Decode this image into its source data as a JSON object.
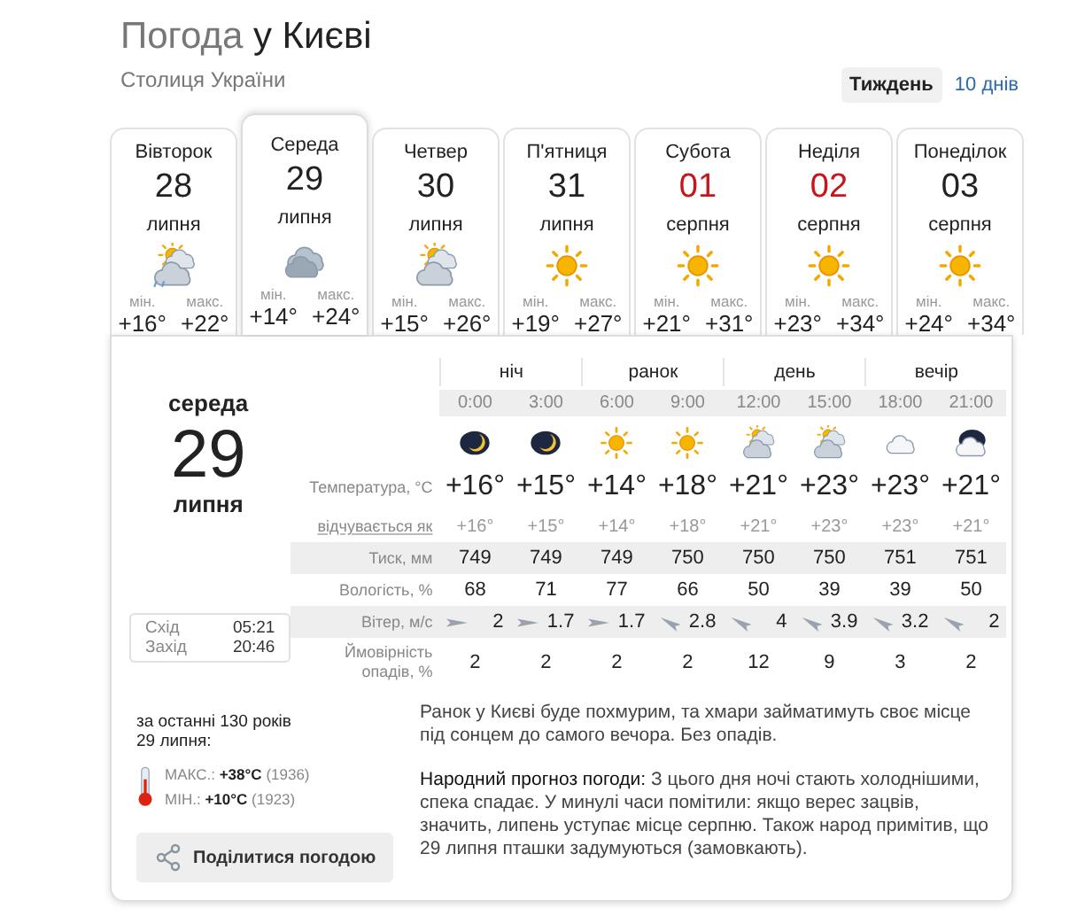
{
  "header": {
    "title_prefix": "Погода",
    "title_place": "у Києві",
    "subtitle": "Столиця України",
    "range_tabs": [
      {
        "label": "Тиждень",
        "selected": true
      },
      {
        "label": "10 днів",
        "selected": false
      }
    ]
  },
  "days": [
    {
      "weekday": "Вівторок",
      "date": "28",
      "month": "липня",
      "kind": "partly-rain",
      "min_label": "мін.",
      "max_label": "макс.",
      "min": "+16°",
      "max": "+22°",
      "selected": false,
      "weekend": false
    },
    {
      "weekday": "Середа",
      "date": "29",
      "month": "липня",
      "kind": "cloud",
      "min_label": "мін.",
      "max_label": "макс.",
      "min": "+14°",
      "max": "+24°",
      "selected": true,
      "weekend": false
    },
    {
      "weekday": "Четвер",
      "date": "30",
      "month": "липня",
      "kind": "partly",
      "min_label": "мін.",
      "max_label": "макс.",
      "min": "+15°",
      "max": "+26°",
      "selected": false,
      "weekend": false
    },
    {
      "weekday": "П'ятниця",
      "date": "31",
      "month": "липня",
      "kind": "sun",
      "min_label": "мін.",
      "max_label": "макс.",
      "min": "+19°",
      "max": "+27°",
      "selected": false,
      "weekend": false
    },
    {
      "weekday": "Субота",
      "date": "01",
      "month": "серпня",
      "kind": "sun",
      "min_label": "мін.",
      "max_label": "макс.",
      "min": "+21°",
      "max": "+31°",
      "selected": false,
      "weekend": true
    },
    {
      "weekday": "Неділя",
      "date": "02",
      "month": "серпня",
      "kind": "sun",
      "min_label": "мін.",
      "max_label": "макс.",
      "min": "+23°",
      "max": "+34°",
      "selected": false,
      "weekend": true
    },
    {
      "weekday": "Понеділок",
      "date": "03",
      "month": "серпня",
      "kind": "sun",
      "min_label": "мін.",
      "max_label": "макс.",
      "min": "+24°",
      "max": "+34°",
      "selected": false,
      "weekend": false
    }
  ],
  "detail": {
    "weekday": "середа",
    "date": "29",
    "month": "липня",
    "sun": {
      "rise_label": "Схід",
      "rise": "05:21",
      "set_label": "Захід",
      "set": "20:46"
    },
    "history": {
      "intro": "за останні 130 років\n29 липня:",
      "max_label": "МАКС.:",
      "max": "+38°C",
      "max_year": "(1936)",
      "min_label": "МІН.:",
      "min": "+10°C",
      "min_year": "(1923)"
    },
    "share_button": "Поділитися погодою",
    "periods": [
      "ніч",
      "ранок",
      "день",
      "вечір"
    ],
    "row_labels": {
      "temperature": "Температура, °C",
      "feels": "відчувається як",
      "pressure": "Тиск, мм",
      "humidity": "Вологість, %",
      "wind": "Вітер, м/с",
      "precip": "Ймовірність опадів, %"
    },
    "hours": [
      {
        "time": "0:00",
        "kind": "moon",
        "temp": "+16°",
        "feels": "+16°",
        "pressure": "749",
        "humidity": "68",
        "wind": {
          "speed": "2",
          "kind": "east"
        },
        "precip": "2"
      },
      {
        "time": "3:00",
        "kind": "moon",
        "temp": "+15°",
        "feels": "+15°",
        "pressure": "749",
        "humidity": "71",
        "wind": {
          "speed": "1.7",
          "kind": "east"
        },
        "precip": "2"
      },
      {
        "time": "6:00",
        "kind": "sun",
        "temp": "+14°",
        "feels": "+14°",
        "pressure": "749",
        "humidity": "77",
        "wind": {
          "speed": "1.7",
          "kind": "east"
        },
        "precip": "2"
      },
      {
        "time": "9:00",
        "kind": "sun",
        "temp": "+18°",
        "feels": "+18°",
        "pressure": "750",
        "humidity": "66",
        "wind": {
          "speed": "2.8",
          "kind": "southeast"
        },
        "precip": "2"
      },
      {
        "time": "12:00",
        "kind": "partly",
        "temp": "+21°",
        "feels": "+21°",
        "pressure": "750",
        "humidity": "50",
        "wind": {
          "speed": "4",
          "kind": "southeast"
        },
        "precip": "12"
      },
      {
        "time": "15:00",
        "kind": "partly",
        "temp": "+23°",
        "feels": "+23°",
        "pressure": "750",
        "humidity": "39",
        "wind": {
          "speed": "3.9",
          "kind": "southeast"
        },
        "precip": "9"
      },
      {
        "time": "18:00",
        "kind": "cloud-light",
        "temp": "+23°",
        "feels": "+23°",
        "pressure": "751",
        "humidity": "39",
        "wind": {
          "speed": "3.2",
          "kind": "southeast"
        },
        "precip": "3"
      },
      {
        "time": "21:00",
        "kind": "night-cloud",
        "temp": "+21°",
        "feels": "+21°",
        "pressure": "751",
        "humidity": "50",
        "wind": {
          "speed": "2",
          "kind": "southeast"
        },
        "precip": "2"
      }
    ],
    "description": "Ранок у Києві буде похмурим, та хмари займатимуть своє місце під сонцем до самого вечора. Без опадів.",
    "folk": "**Народний прогноз погоди:** З цього дня ночі стають холоднішими, спека спадає. У минулі часи помітили: якщо верес зацвів, значить, липень уступає місце серпню. Також народ примітив, що 29 липня пташки задумуються (замовкають)."
  }
}
